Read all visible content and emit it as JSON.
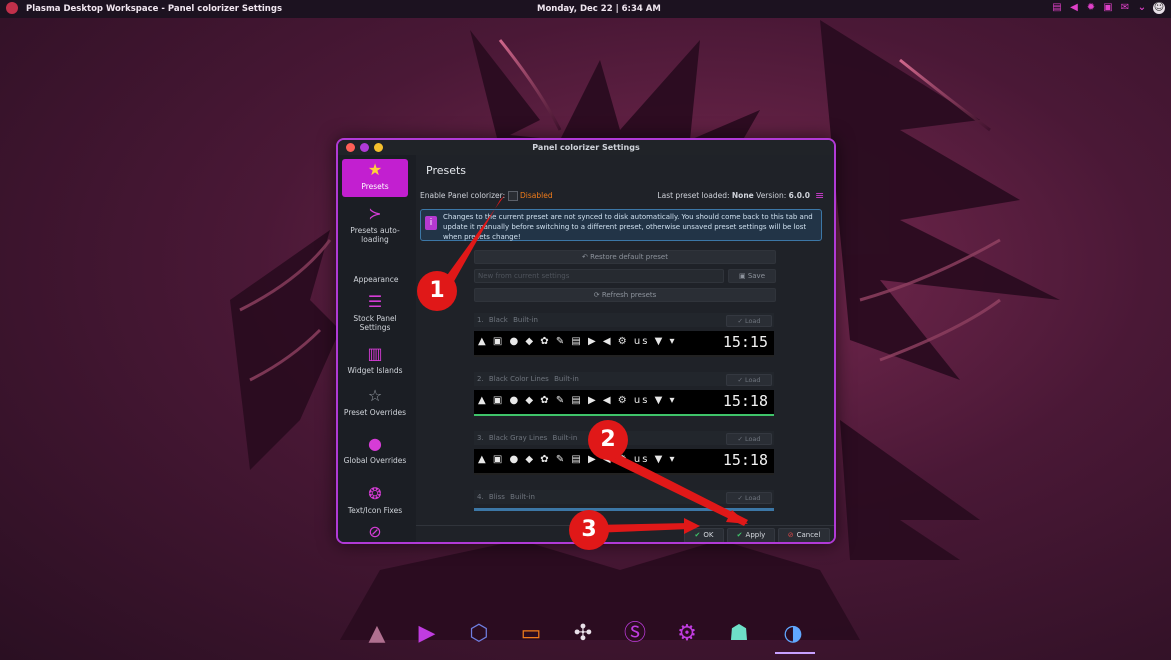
{
  "topbar": {
    "window_title": "Plasma Desktop Workspace - Panel colorizer Settings",
    "clock": "Monday, Dec 22 | 6:34 AM",
    "tray_icons": [
      "clipboard-icon",
      "volume-icon",
      "brightness-icon",
      "display-icon",
      "mail-icon",
      "chevron-down-icon",
      "user-icon"
    ]
  },
  "window": {
    "title": "Panel colorizer Settings",
    "sidebar": {
      "items": [
        {
          "label": "Presets",
          "icon": "star-icon"
        },
        {
          "label": "Presets auto-loading",
          "icon": "list-icon"
        },
        {
          "label": "Stock Panel Settings",
          "icon": "toggles-icon"
        },
        {
          "label": "Widget Islands",
          "icon": "columns-icon"
        },
        {
          "label": "Preset Overrides",
          "icon": "star-outline-icon"
        },
        {
          "label": "Global Overrides",
          "icon": "globe-icon"
        },
        {
          "label": "Text/Icon Fixes",
          "icon": "rings-icon"
        }
      ],
      "section_appearance": "Appearance"
    },
    "content": {
      "page_title": "Presets",
      "enable_label": "Enable Panel colorizer:",
      "enable_state": "Disabled",
      "last_preset_label": "Last preset loaded:",
      "last_preset_value": "None",
      "version_label": "Version:",
      "version_value": "6.0.0",
      "info_text": "Changes to the current preset are not synced to disk automatically. You should come back to this tab and update it manually before switching to a different preset, otherwise unsaved preset settings will be lost when presets change!",
      "restore_button": "Restore default preset",
      "new_preset_placeholder": "New from current settings",
      "save_button": "Save",
      "refresh_button": "Refresh presets",
      "presets": [
        {
          "index": "1.",
          "name": "Black",
          "tag": "Built-in",
          "time": "15:15",
          "load": "Load"
        },
        {
          "index": "2.",
          "name": "Black Color Lines",
          "tag": "Built-in",
          "time": "15:18",
          "load": "Load"
        },
        {
          "index": "3.",
          "name": "Black Gray Lines",
          "tag": "Built-in",
          "time": "15:18",
          "load": "Load"
        },
        {
          "index": "4.",
          "name": "Bliss",
          "tag": "Built-in",
          "time": "",
          "load": "Load"
        }
      ],
      "panel_icons_text": "▲ ▣ ● ◆ ✿ ✎ ▤ ▶ ◀ ⚙ us ▼ ▾"
    },
    "footer": {
      "ok": "OK",
      "apply": "Apply",
      "cancel": "Cancel"
    }
  },
  "annotations": [
    "1",
    "2",
    "3"
  ],
  "dock": {
    "items": [
      "eagle-icon",
      "terminal-icon",
      "dolphin-icon",
      "folder-icon",
      "network-icon",
      "skype-icon",
      "settings-icon",
      "ghost-icon",
      "panel-colorizer-icon"
    ]
  },
  "colors": {
    "accent": "#c21fd0",
    "disabled": "#f07c1a",
    "badge": "#e01818"
  }
}
